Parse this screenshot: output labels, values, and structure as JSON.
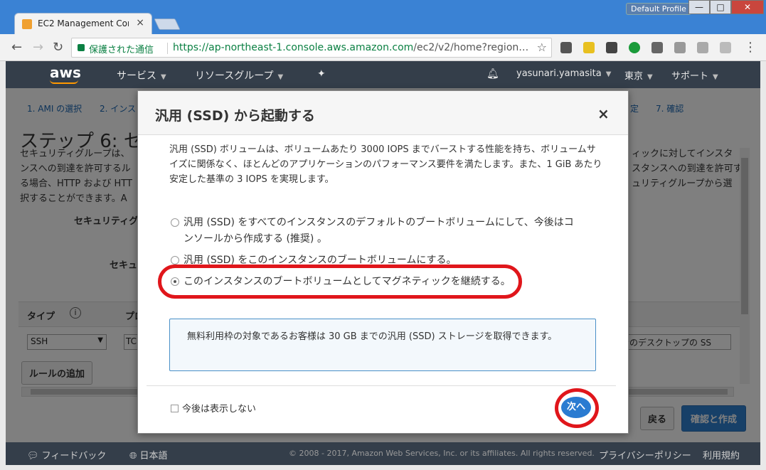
{
  "browser": {
    "profile": "Default Profile",
    "tab_title": "EC2 Management Con",
    "secure_label": "保護された通信",
    "url_host": "https://ap-northeast-1.console.aws.amazon.com",
    "url_path": "/ec2/v2/home?region…"
  },
  "aws_nav": {
    "logo": "aws",
    "services": "サービス",
    "resource_groups": "リソースグループ",
    "user": "yasunari.yamasita",
    "region": "東京",
    "support": "サポート"
  },
  "background_page": {
    "steps": [
      "1. AMI の選択",
      "2. インス",
      "定",
      "7. 確認"
    ],
    "heading": "ステップ 6: セキ",
    "desc_left": [
      "セキュリティグループは、",
      "ンスへの到達を許可するル",
      "る場合、HTTP および HTT",
      "択することができます。A"
    ],
    "desc_right": [
      "ィックに対してインスタ",
      "スタンスへの到達を許可す",
      "ュリティグループから選"
    ],
    "label_sg": "セキュリティグ",
    "label_sg2": "セキュ",
    "col_type": "タイプ",
    "col_proto": "プロ",
    "rule_type": "SSH",
    "rule_proto": "TC",
    "rule_desc": "者のデスクトップの SS",
    "add_rule": "ルールの追加",
    "back": "戻る",
    "review_launch": "確認と作成"
  },
  "modal": {
    "title": "汎用 (SSD) から起動する",
    "close": "×",
    "description": "汎用 (SSD) ボリュームは、ボリュームあたり 3000 IOPS までバーストする性能を持ち、ボリュームサイズに関係なく、ほとんどのアプリケーションのパフォーマンス要件を満たします。また、1 GiB あたり安定した基準の 3 IOPS を実現します。",
    "options": [
      {
        "label": "汎用 (SSD) をすべてのインスタンスのデフォルトのブートボリュームにして、今後はコンソールから作成する (推奨) 。",
        "checked": false
      },
      {
        "label": "汎用 (SSD) をこのインスタンスのブートボリュームにする。",
        "checked": false
      },
      {
        "label": "このインスタンスのブートボリュームとしてマグネティックを継続する。",
        "checked": true
      }
    ],
    "info": "無料利用枠の対象であるお客様は 30 GB までの汎用 (SSD) ストレージを取得できます。",
    "dont_show": "今後は表示しない",
    "next": "次へ"
  },
  "footer": {
    "feedback": "フィードバック",
    "language": "日本語",
    "copyright": "© 2008 - 2017, Amazon Web Services, Inc. or its affiliates. All rights reserved.",
    "privacy": "プライバシーポリシー",
    "terms": "利用規約"
  },
  "colors": {
    "aws_nav": "#343e4a",
    "primary_button": "#2a7bd1",
    "annotation_red": "#e0161b"
  }
}
